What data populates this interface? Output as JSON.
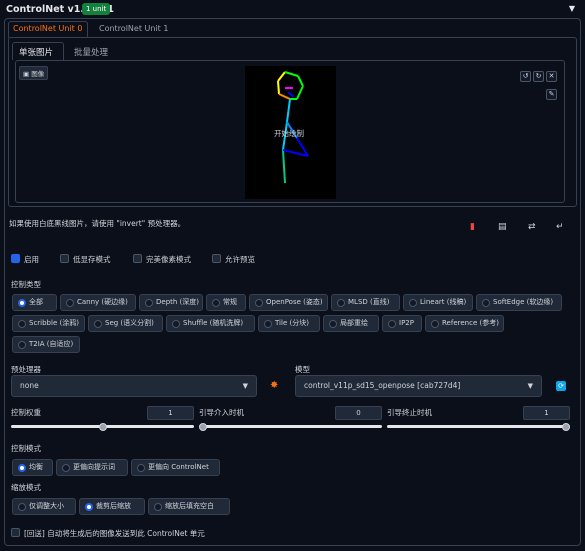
{
  "header": {
    "title": "ControlNet v1.1.231",
    "badge": "1 unit",
    "collapse_icon": "triangle-down-icon"
  },
  "unit_tabs": [
    {
      "label": "ControlNet Unit 0",
      "active": true
    },
    {
      "label": "ControlNet Unit 1",
      "active": false
    }
  ],
  "sub_tabs": [
    {
      "label": "单张图片",
      "active": true
    },
    {
      "label": "批量处理",
      "active": false
    }
  ],
  "image": {
    "label": "图像",
    "overlay_text": "开始绘制"
  },
  "hint": "如果使用白底黑线图片，请使用 \"invert\" 预处理器。",
  "checkboxes": [
    {
      "label": "启用",
      "checked": true
    },
    {
      "label": "低显存模式",
      "checked": false
    },
    {
      "label": "完美像素模式",
      "checked": false
    },
    {
      "label": "允许预览",
      "checked": false
    }
  ],
  "control_type": {
    "label": "控制类型",
    "options": [
      {
        "label": "全部",
        "selected": true
      },
      {
        "label": "Canny (硬边缘)",
        "selected": false
      },
      {
        "label": "Depth (深度)",
        "selected": false
      },
      {
        "label": "常规",
        "selected": false
      },
      {
        "label": "OpenPose (姿态)",
        "selected": false
      },
      {
        "label": "MLSD (直线)",
        "selected": false
      },
      {
        "label": "Lineart (线稿)",
        "selected": false
      },
      {
        "label": "SoftEdge (软边缘)",
        "selected": false
      },
      {
        "label": "Scribble (涂鸦)",
        "selected": false
      },
      {
        "label": "Seg (语义分割)",
        "selected": false
      },
      {
        "label": "Shuffle (随机洗牌)",
        "selected": false
      },
      {
        "label": "Tile (分块)",
        "selected": false
      },
      {
        "label": "局部重绘",
        "selected": false
      },
      {
        "label": "IP2P",
        "selected": false
      },
      {
        "label": "Reference (参考)",
        "selected": false
      },
      {
        "label": "T2IA (自适应)",
        "selected": false
      }
    ]
  },
  "preprocessor": {
    "label": "预处理器",
    "value": "none"
  },
  "model": {
    "label": "模型",
    "value": "control_v11p_sd15_openpose [cab727d4]"
  },
  "sliders": [
    {
      "label": "控制权重",
      "value": "1",
      "fraction": 0.5
    },
    {
      "label": "引导介入时机",
      "value": "0",
      "fraction": 0.0
    },
    {
      "label": "引导终止时机",
      "value": "1",
      "fraction": 1.0
    }
  ],
  "control_mode": {
    "label": "控制模式",
    "options": [
      {
        "label": "均衡",
        "selected": true
      },
      {
        "label": "更偏向提示词",
        "selected": false
      },
      {
        "label": "更偏向 ControlNet",
        "selected": false
      }
    ]
  },
  "resize_mode": {
    "label": "缩放模式",
    "options": [
      {
        "label": "仅调整大小",
        "selected": false
      },
      {
        "label": "裁剪后缩放",
        "selected": true
      },
      {
        "label": "缩放后填充空白",
        "selected": false
      }
    ]
  },
  "loopback": {
    "label": "[回送] 自动将生成后的图像发送到此 ControlNet 单元",
    "checked": false
  },
  "colors": {
    "accent": "#f97316",
    "selected": "#2563eb",
    "badge": "#15803d"
  }
}
